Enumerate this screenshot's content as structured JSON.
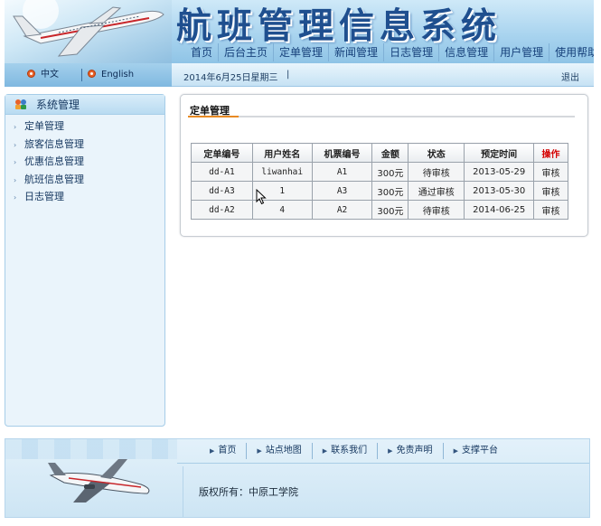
{
  "header": {
    "title": "航班管理信息系统",
    "nav": [
      "首页",
      "后台主页",
      "定单管理",
      "新闻管理",
      "日志管理",
      "信息管理",
      "用户管理",
      "使用帮助"
    ]
  },
  "status_bar": {
    "lang_cn": "中文",
    "lang_en": "English",
    "date": "2014年6月25日星期三",
    "caret": "|",
    "logout": "退出"
  },
  "sidebar": {
    "title": "系统管理",
    "items": [
      "定单管理",
      "旅客信息管理",
      "优惠信息管理",
      "航班信息管理",
      "日志管理"
    ]
  },
  "main": {
    "panel_title": "定单管理",
    "table": {
      "headers": [
        "定单编号",
        "用户姓名",
        "机票编号",
        "金额",
        "状态",
        "预定时间",
        "操作"
      ],
      "rows": [
        [
          "dd-A1",
          "liwanhai",
          "A1",
          "300元",
          "待审核",
          "2013-05-29",
          "审核"
        ],
        [
          "dd-A3",
          "1",
          "A3",
          "300元",
          "通过审核",
          "2013-05-30",
          "审核"
        ],
        [
          "dd-A2",
          "4",
          "A2",
          "300元",
          "待审核",
          "2014-06-25",
          "审核"
        ]
      ]
    }
  },
  "footer": {
    "nav": [
      "首页",
      "站点地图",
      "联系我们",
      "免责声明",
      "支撑平台"
    ],
    "copyright": "版权所有：中原工学院"
  },
  "colors": {
    "accent_orange": "#e88a23",
    "header_blue": "#1f4f8f",
    "operation_red": "#d40000"
  },
  "icons": [
    "plane-logo-icon",
    "language-dot-icon",
    "system-manage-icon",
    "arrow-right-icon",
    "mouse-pointer-icon"
  ]
}
